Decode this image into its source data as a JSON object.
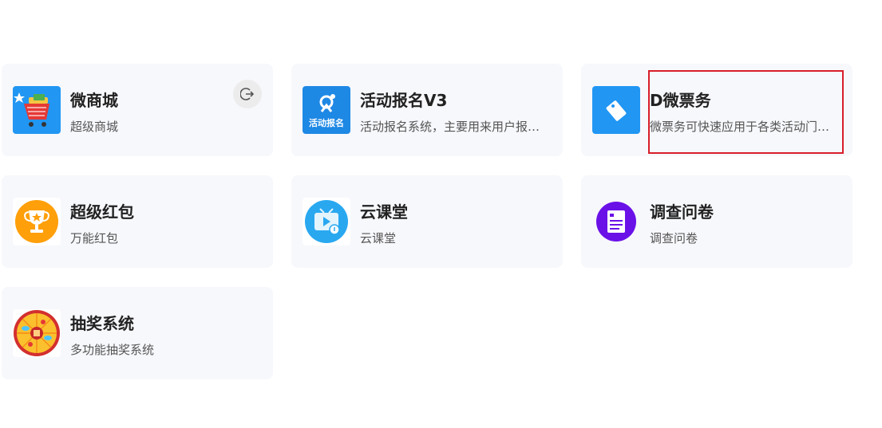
{
  "apps": [
    {
      "id": "mall",
      "title": "微商城",
      "desc": "超级商城",
      "icon": "shopping-cart-icon"
    },
    {
      "id": "signup",
      "title": "活动报名V3",
      "desc": "活动报名系统，主要用来用户报名活动",
      "icon_text": "活动报名",
      "icon": "activity-signup-icon"
    },
    {
      "id": "ticket",
      "title": "D微票务",
      "desc": "微票务可快速应用于各类活动门票销售",
      "icon": "ticket-tag-icon"
    },
    {
      "id": "redpacket",
      "title": "超级红包",
      "desc": "万能红包",
      "icon": "trophy-icon"
    },
    {
      "id": "classroom",
      "title": "云课堂",
      "desc": "云课堂",
      "icon": "video-play-icon"
    },
    {
      "id": "survey",
      "title": "调查问卷",
      "desc": "调查问卷",
      "icon": "document-icon"
    },
    {
      "id": "lottery",
      "title": "抽奖系统",
      "desc": "多功能抽奖系统",
      "icon": "lottery-wheel-icon"
    }
  ],
  "colors": {
    "card_bg": "#f7f8fc",
    "highlight": "#d81e2a",
    "blue": "#1e90ff",
    "purple": "#6a11e8"
  }
}
